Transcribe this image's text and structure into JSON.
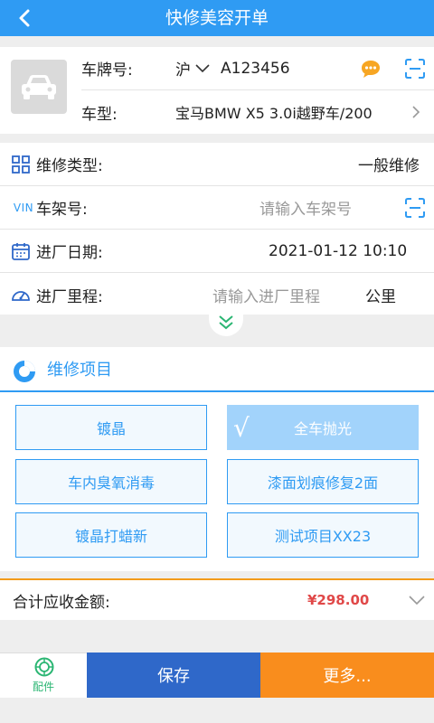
{
  "header": {
    "title": "快修美容开单"
  },
  "vehicle": {
    "plate_label": "车牌号:",
    "province": "沪",
    "plate_number": "A123456",
    "model_label": "车型:",
    "model_value": "宝马BMW X5 3.0i越野车/200"
  },
  "info": {
    "repair_type_label": "维修类型:",
    "repair_type_value": "一般维修",
    "vin_icon_text": "VIN",
    "vin_label": "车架号:",
    "vin_placeholder": "请输入车架号",
    "date_label": "进厂日期:",
    "date_value": "2021-01-12 10:10",
    "mileage_label": "进厂里程:",
    "mileage_placeholder": "请输入进厂里程",
    "mileage_unit": "公里"
  },
  "items": {
    "title": "维修项目",
    "services": [
      {
        "label": "镀晶",
        "selected": false
      },
      {
        "label": "全车抛光",
        "selected": true
      },
      {
        "label": "车内臭氧消毒",
        "selected": false
      },
      {
        "label": "漆面划痕修复2面",
        "selected": false
      },
      {
        "label": "镀晶打蜡新",
        "selected": false
      },
      {
        "label": "测试项目XX23",
        "selected": false
      }
    ],
    "check_mark": "√"
  },
  "total": {
    "label": "合计应收金额:",
    "amount": "¥298.00"
  },
  "tabbar": {
    "parts_label": "配件",
    "save_label": "保存",
    "more_label": "更多..."
  },
  "colors": {
    "primary": "#2f9bf3",
    "save": "#2f68c9",
    "more": "#f98d1d",
    "amount": "#e04848",
    "parts": "#2bb673"
  }
}
